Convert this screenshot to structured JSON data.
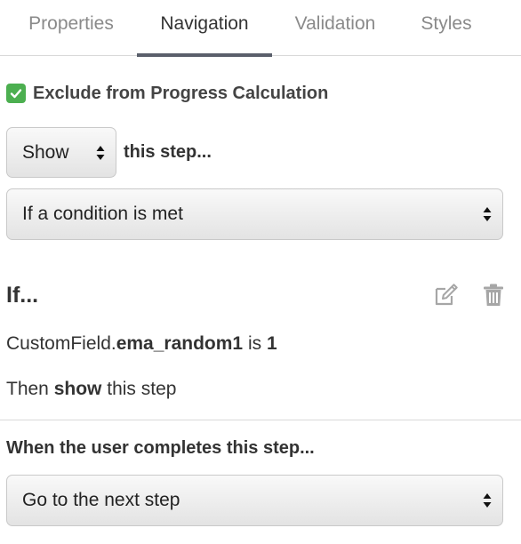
{
  "tabs": [
    {
      "label": "Properties"
    },
    {
      "label": "Navigation"
    },
    {
      "label": "Validation"
    },
    {
      "label": "Styles"
    }
  ],
  "active_tab": "Navigation",
  "exclude": {
    "label": "Exclude from Progress Calculation",
    "checked": true
  },
  "visibility": {
    "select_value": "Show",
    "suffix": "this step..."
  },
  "condition_mode": {
    "select_value": "If a condition is met"
  },
  "condition": {
    "heading": "If...",
    "field_prefix": "CustomField.",
    "field_name": "ema_random1",
    "operator": "is",
    "value": "1",
    "then_prefix": "Then",
    "then_action": "show",
    "then_suffix": "this step"
  },
  "completion": {
    "heading": "When the user completes this step...",
    "select_value": "Go to the next step"
  },
  "colors": {
    "accent": "#4caf50",
    "tab_underline": "#5a5f6b",
    "icon_gray": "#a6a6a6"
  }
}
